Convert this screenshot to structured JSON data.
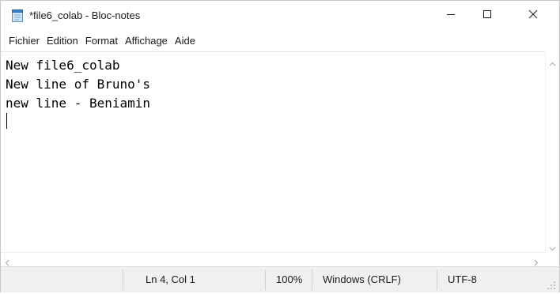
{
  "window": {
    "title": "*file6_colab - Bloc-notes",
    "icon": "notepad-icon",
    "controls": {
      "minimize": "minimize-icon",
      "maximize": "maximize-icon",
      "close": "close-icon"
    }
  },
  "menu": {
    "items": [
      "Fichier",
      "Edition",
      "Format",
      "Affichage",
      "Aide"
    ]
  },
  "editor": {
    "lines": [
      "New file6_colab",
      "New line of Bruno's",
      "new line - Beniamin",
      ""
    ]
  },
  "status": {
    "position": "Ln 4, Col 1",
    "zoom": "100%",
    "line_ending": "Windows (CRLF)",
    "encoding": "UTF-8"
  }
}
